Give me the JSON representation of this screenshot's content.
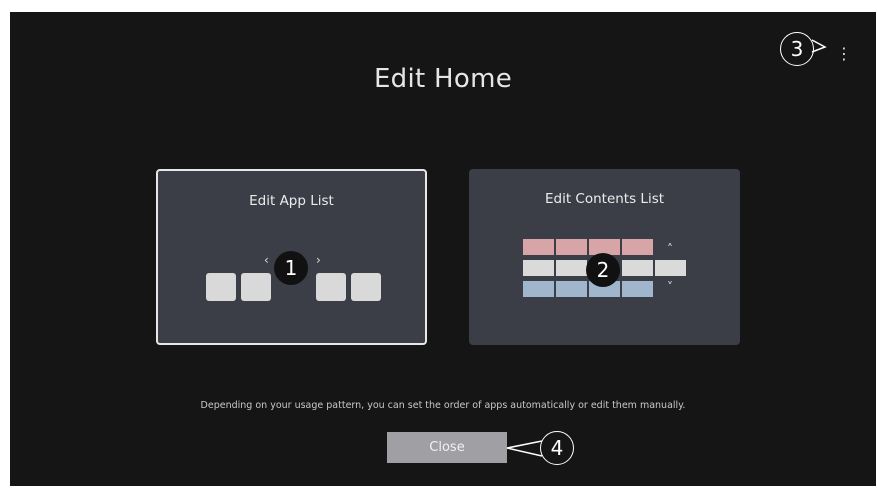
{
  "screen": {
    "title": "Edit Home",
    "description": "Depending on your usage pattern, you can set the order of apps automatically or edit them manually.",
    "close_label": "Close",
    "more_icon": "⋮"
  },
  "cards": {
    "app_list": {
      "label": "Edit App List",
      "arrow_left": "‹",
      "arrow_right": "›"
    },
    "contents_list": {
      "label": "Edit Contents List",
      "arrow_up": "˄",
      "arrow_down": "˅"
    }
  },
  "callouts": {
    "one": "1",
    "two": "2",
    "three": "3",
    "four": "4"
  }
}
